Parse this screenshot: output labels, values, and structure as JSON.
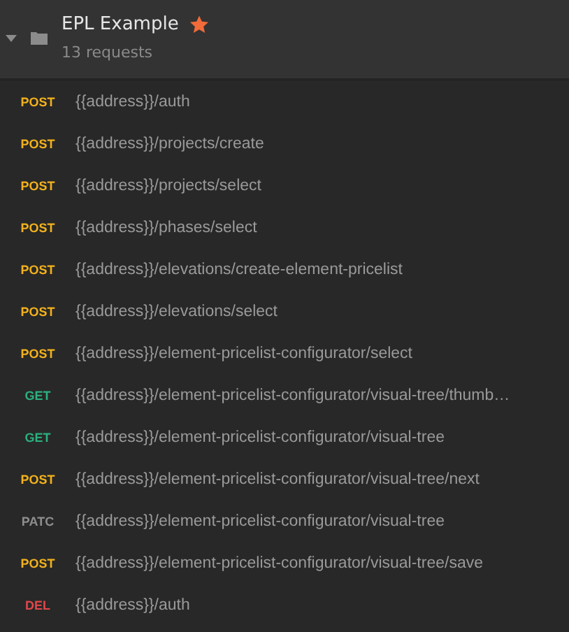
{
  "collection": {
    "name": "EPL Example",
    "expanded": true,
    "starred": true,
    "count": "13 requests"
  },
  "requests": [
    {
      "method": "POST",
      "kind": "post",
      "url": "{{address}}/auth"
    },
    {
      "method": "POST",
      "kind": "post",
      "url": "{{address}}/projects/create"
    },
    {
      "method": "POST",
      "kind": "post",
      "url": "{{address}}/projects/select"
    },
    {
      "method": "POST",
      "kind": "post",
      "url": "{{address}}/phases/select"
    },
    {
      "method": "POST",
      "kind": "post",
      "url": "{{address}}/elevations/create-element-pricelist"
    },
    {
      "method": "POST",
      "kind": "post",
      "url": "{{address}}/elevations/select"
    },
    {
      "method": "POST",
      "kind": "post",
      "url": "{{address}}/element-pricelist-configurator/select"
    },
    {
      "method": "GET",
      "kind": "get",
      "url": "{{address}}/element-pricelist-configurator/visual-tree/thumb…"
    },
    {
      "method": "GET",
      "kind": "get",
      "url": "{{address}}/element-pricelist-configurator/visual-tree"
    },
    {
      "method": "POST",
      "kind": "post",
      "url": "{{address}}/element-pricelist-configurator/visual-tree/next"
    },
    {
      "method": "PATC",
      "kind": "patch",
      "url": "{{address}}/element-pricelist-configurator/visual-tree"
    },
    {
      "method": "POST",
      "kind": "post",
      "url": "{{address}}/element-pricelist-configurator/visual-tree/save"
    },
    {
      "method": "DEL",
      "kind": "delete",
      "url": "{{address}}/auth"
    }
  ]
}
